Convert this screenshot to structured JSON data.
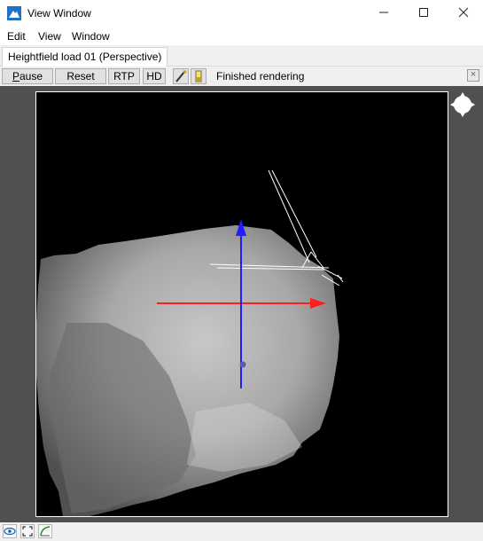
{
  "window": {
    "title": "View Window",
    "icon": "mountain-app-icon",
    "controls": {
      "minimize": "minimize-icon",
      "maximize": "maximize-icon",
      "close": "close-icon"
    }
  },
  "menu": {
    "items": [
      "Edit",
      "View",
      "Window"
    ]
  },
  "tab": {
    "label": "Heightfield load 01 (Perspective)"
  },
  "toolbar": {
    "pause_first": "P",
    "pause_rest": "ause",
    "reset": "Reset",
    "rtp": "RTP",
    "hd": "HD",
    "tools": [
      "paint-brush-icon",
      "battery-icon"
    ],
    "status": "Finished rendering",
    "close_icon": "close-panel-icon"
  },
  "viewport": {
    "content": "heightfield-render",
    "gizmo": "navigation-gizmo-icon",
    "axis_colors": {
      "x": "#ff1e1e",
      "y": "#1e1eff"
    }
  },
  "statusbar": {
    "icons": [
      "eye-icon",
      "frame-icon",
      "curve-icon"
    ]
  }
}
